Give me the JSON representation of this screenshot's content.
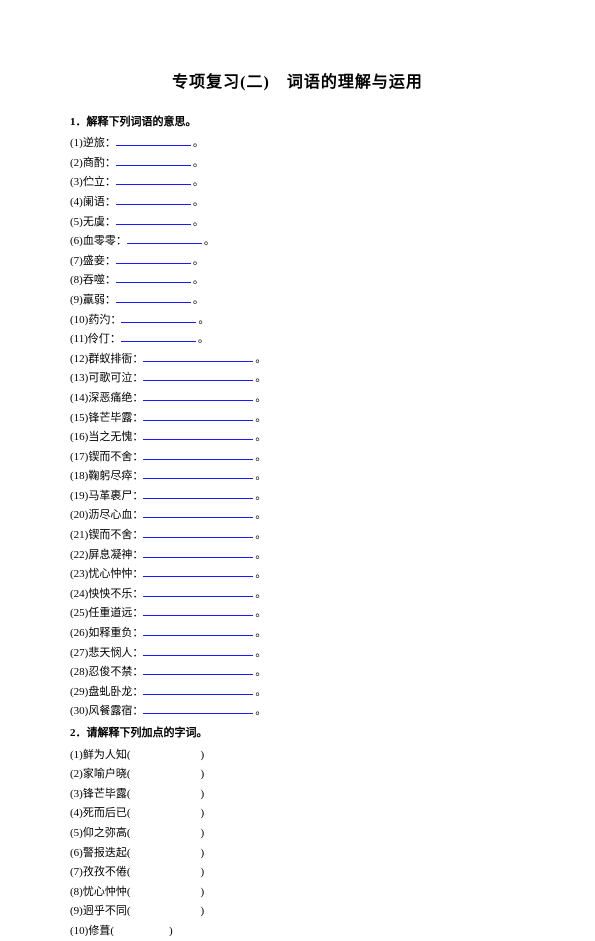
{
  "title": "专项复习(二)　词语的理解与运用",
  "section1": {
    "header": "1．解释下列词语的意思。",
    "items": [
      {
        "num": "(1)",
        "word": "逆旅",
        "len": "short"
      },
      {
        "num": "(2)",
        "word": "商酌",
        "len": "short"
      },
      {
        "num": "(3)",
        "word": "伫立",
        "len": "short"
      },
      {
        "num": "(4)",
        "word": "阑语",
        "len": "short"
      },
      {
        "num": "(5)",
        "word": "无虞",
        "len": "short"
      },
      {
        "num": "(6)",
        "word": "血零零",
        "len": "short"
      },
      {
        "num": "(7)",
        "word": "盛妾",
        "len": "short"
      },
      {
        "num": "(8)",
        "word": "吞噬",
        "len": "short"
      },
      {
        "num": "(9)",
        "word": "羸弱",
        "len": "short"
      },
      {
        "num": "(10)",
        "word": "药汋",
        "len": "short"
      },
      {
        "num": "(11)",
        "word": "伶仃",
        "len": "short"
      },
      {
        "num": "(12)",
        "word": "群蚁排衙",
        "len": "long"
      },
      {
        "num": "(13)",
        "word": "可歌可泣",
        "len": "long"
      },
      {
        "num": "(14)",
        "word": "深恶痛绝",
        "len": "long"
      },
      {
        "num": "(15)",
        "word": "锋芒毕露",
        "len": "long"
      },
      {
        "num": "(16)",
        "word": "当之无愧",
        "len": "long"
      },
      {
        "num": "(17)",
        "word": "锲而不舍",
        "len": "long"
      },
      {
        "num": "(18)",
        "word": "鞠躬尽瘁",
        "len": "long"
      },
      {
        "num": "(19)",
        "word": "马革裹尸",
        "len": "long"
      },
      {
        "num": "(20)",
        "word": "沥尽心血",
        "len": "long"
      },
      {
        "num": "(21)",
        "word": "锲而不舍",
        "len": "long"
      },
      {
        "num": "(22)",
        "word": "屏息凝神",
        "len": "long"
      },
      {
        "num": "(23)",
        "word": "忧心忡忡",
        "len": "long"
      },
      {
        "num": "(24)",
        "word": "怏怏不乐",
        "len": "long"
      },
      {
        "num": "(25)",
        "word": "任重道远",
        "len": "long"
      },
      {
        "num": "(26)",
        "word": "如释重负",
        "len": "long"
      },
      {
        "num": "(27)",
        "word": "悲天悯人",
        "len": "long"
      },
      {
        "num": "(28)",
        "word": "忍俊不禁",
        "len": "long"
      },
      {
        "num": "(29)",
        "word": "盘虬卧龙",
        "len": "long"
      },
      {
        "num": "(30)",
        "word": "风餐露宿",
        "len": "long"
      }
    ]
  },
  "section2": {
    "header": "2．请解释下列加点的字词。",
    "items": [
      {
        "num": "(1)",
        "word": "鲜为人知("
      },
      {
        "num": "(2)",
        "word": "家喻户晓("
      },
      {
        "num": "(3)",
        "word": "锋芒毕露("
      },
      {
        "num": "(4)",
        "word": "死而后已("
      },
      {
        "num": "(5)",
        "word": "仰之弥高("
      },
      {
        "num": "(6)",
        "word": "警报迭起("
      },
      {
        "num": "(7)",
        "word": "孜孜不倦("
      },
      {
        "num": "(8)",
        "word": "忧心忡忡("
      },
      {
        "num": "(9)",
        "word": "迥乎不同("
      },
      {
        "num": "(10)",
        "word": "修葺(",
        "short": true
      }
    ]
  }
}
